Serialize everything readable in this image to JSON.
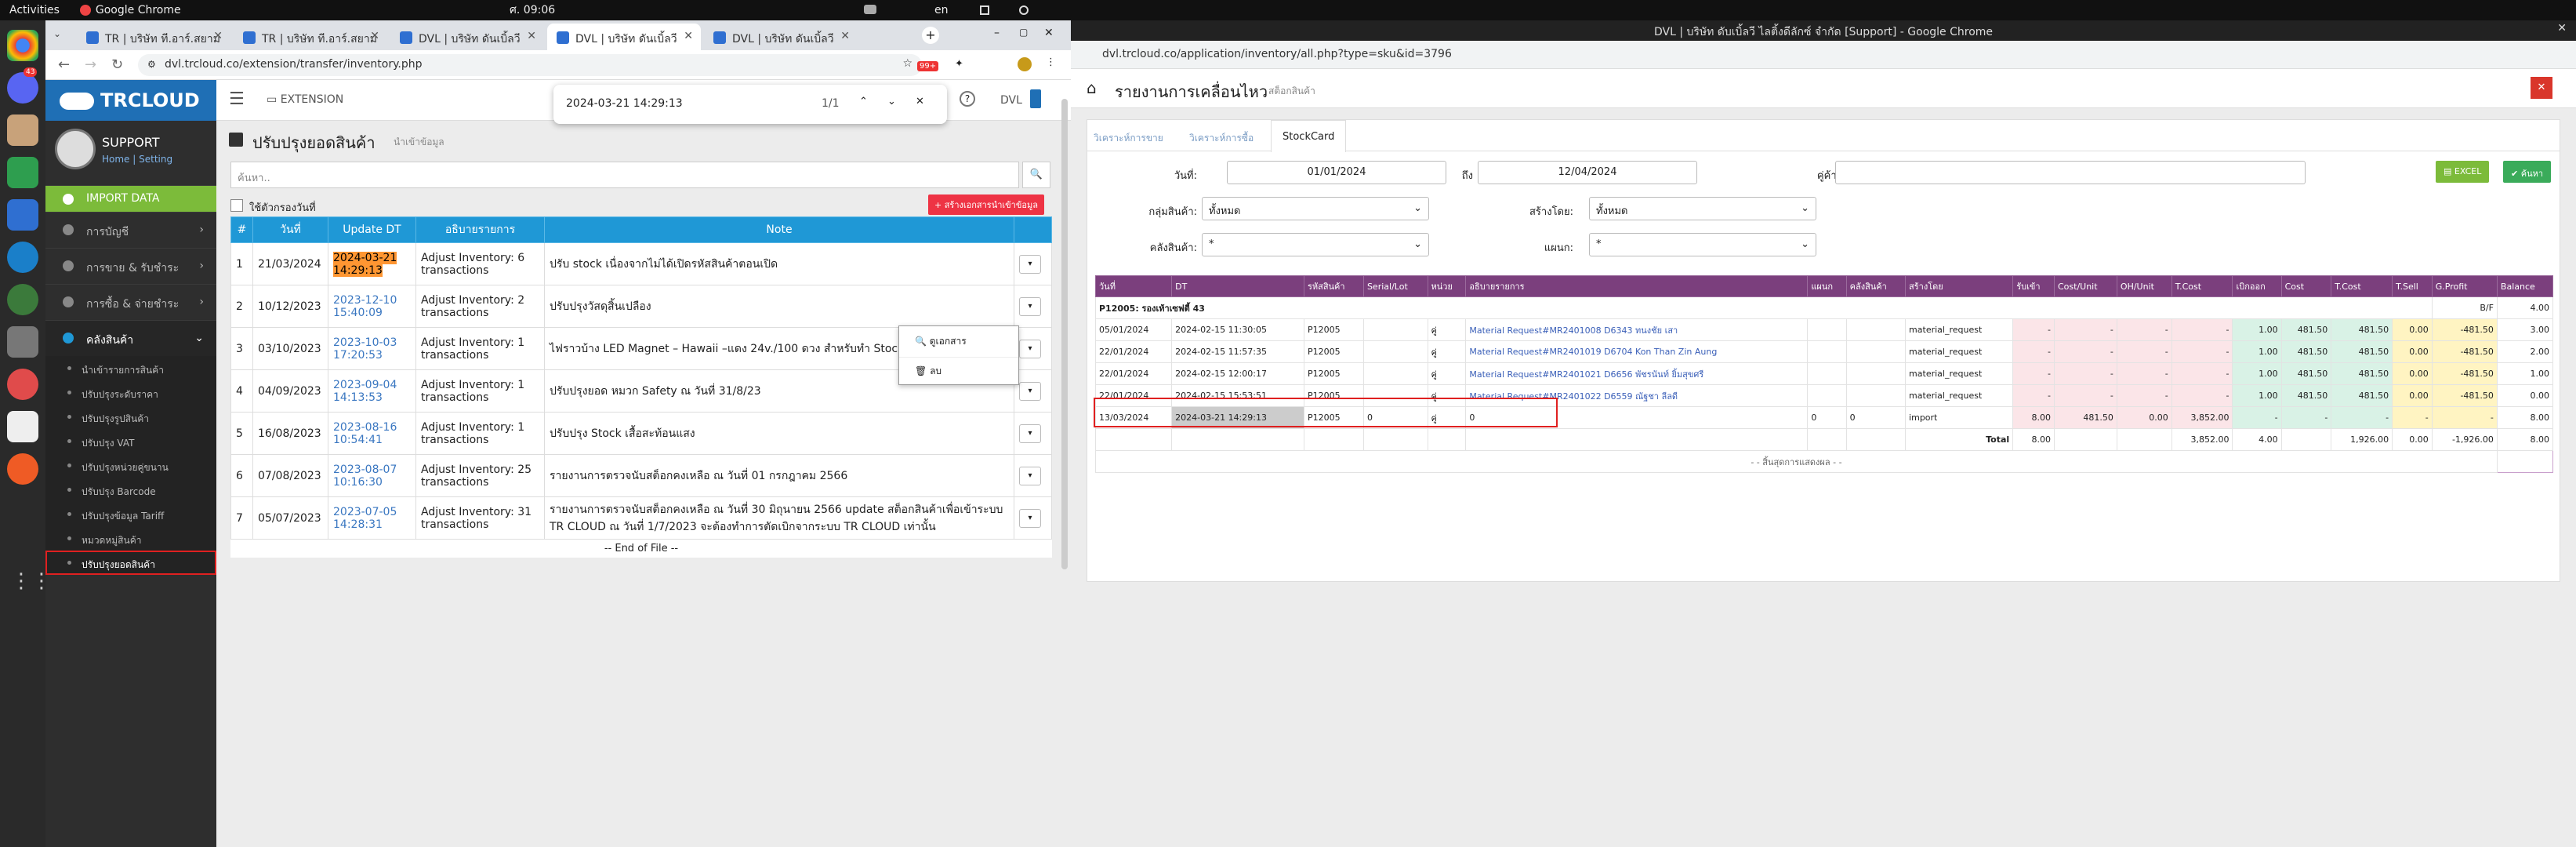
{
  "topbar": {
    "activities": "Activities",
    "app": "Google Chrome",
    "clock": "ศ. 09:06",
    "lang": "en"
  },
  "dock": {
    "badge": "43"
  },
  "left_window": {
    "tabs": [
      {
        "label": "TR | บริษัท ที.อาร์.สยาม"
      },
      {
        "label": "TR | บริษัท ที.อาร์.สยาม"
      },
      {
        "label": "DVL | บริษัท ดันเบิ้ลวี"
      },
      {
        "label": "DVL | บริษัท ดันเบิ้ลวี"
      },
      {
        "label": "DVL | บริษัท ดันเบิ้ลวี"
      }
    ],
    "url": "dvl.trcloud.co/extension/transfer/inventory.php",
    "ext_badge": "99+",
    "find": {
      "query": "2024-03-21 14:29:13",
      "count": "1/1"
    },
    "sidebar": {
      "logo": "TRCLOUD",
      "user": "SUPPORT",
      "home": "Home",
      "setting": "Setting",
      "menu": [
        {
          "label": "IMPORT DATA"
        },
        {
          "label": "การบัญชี"
        },
        {
          "label": "การขาย & รับชำระ"
        },
        {
          "label": "การซื้อ & จ่ายชำระ"
        },
        {
          "label": "คลังสินค้า"
        }
      ],
      "sub": [
        "นำเข้ารายการสินค้า",
        "ปรับปรุงระดับราคา",
        "ปรับปรุงรูปสินค้า",
        "ปรับปรุง VAT",
        "ปรับปรุงหน่วยคู่ขนาน",
        "ปรับปรุง Barcode",
        "ปรับปรุงข้อมูล Tariff",
        "หมวดหมู่สินค้า",
        "ปรับปรุงยอดสินค้า"
      ]
    },
    "header": {
      "extension": "EXTENSION",
      "dvl": "DVL"
    },
    "page": {
      "title": "ปรับปรุงยอดสินค้า",
      "subtitle": "นำเข้าข้อมูล",
      "search_placeholder": "ค้นหา..",
      "checkbox": "ใช้ตัวกรองวันที่",
      "create_btn": "+ สร้างเอกสารนำเข้าข้อมูล",
      "columns": [
        "#",
        "วันที่",
        "Update DT",
        "อธิบายรายการ",
        "Note"
      ],
      "rows": [
        {
          "n": "1",
          "date": "21/03/2024",
          "dt": "2024-03-21 14:29:13",
          "desc": "Adjust Inventory: 6 transactions",
          "note": "ปรับ stock เนื่องจากไม่ได้เปิดรหัสสินค้าตอนเปิด"
        },
        {
          "n": "2",
          "date": "10/12/2023",
          "dt": "2023-12-10 15:40:09",
          "desc": "Adjust Inventory: 2 transactions",
          "note": "ปรับปรุงวัสดุสิ้นเปลือง"
        },
        {
          "n": "3",
          "date": "03/10/2023",
          "dt": "2023-10-03 17:20:53",
          "desc": "Adjust Inventory: 1 transactions",
          "note": "ไฟราวบ้าง LED Magnet – Hawaii –แดง 24v./100 ดวง สำหรับทำ Stock"
        },
        {
          "n": "4",
          "date": "04/09/2023",
          "dt": "2023-09-04 14:13:53",
          "desc": "Adjust Inventory: 1 transactions",
          "note": "ปรับปรุงยอด หมวก Safety ณ วันที่ 31/8/23"
        },
        {
          "n": "5",
          "date": "16/08/2023",
          "dt": "2023-08-16 10:54:41",
          "desc": "Adjust Inventory: 1 transactions",
          "note": "ปรับปรุง Stock เสื้อสะท้อนแสง"
        },
        {
          "n": "6",
          "date": "07/08/2023",
          "dt": "2023-08-07 10:16:30",
          "desc": "Adjust Inventory: 25 transactions",
          "note": "รายงานการตรวจนับสต็อกคงเหลือ ณ วันที่ 01 กรกฎาคม 2566"
        },
        {
          "n": "7",
          "date": "05/07/2023",
          "dt": "2023-07-05 14:28:31",
          "desc": "Adjust Inventory: 31 transactions",
          "note": "รายงานการตรวจนับสต็อกคงเหลือ ณ วันที่ 30 มิถุนายน 2566 update สต็อกสินค้าเพื่อเข้าระบบ TR CLOUD ณ วันที่ 1/7/2023 จะต้องทำการตัดเบิกจากระบบ TR CLOUD เท่านั้น"
        }
      ],
      "end": "-- End of File --",
      "dropdown": [
        "ดูเอกสาร",
        "ลบ"
      ]
    }
  },
  "right_window": {
    "title": "DVL | บริษัท ดับเบิ้ลวี ไลติ้งดีลักซ์ จำกัด [Support] - Google Chrome",
    "url": "dvl.trcloud.co/application/inventory/all.php?type=sku&id=3796",
    "page_title": "รายงานการเคลื่อนไหว",
    "page_sub": "สต็อกสินค้า",
    "tabs": [
      "วิเคราะห์การขาย",
      "วิเคราะห์การซื้อ",
      "StockCard"
    ],
    "filters": {
      "date_label": "วันที่:",
      "date_from": "01/01/2024",
      "to": "ถึง",
      "date_to": "12/04/2024",
      "partner_label": "คู่ค้า:",
      "group_label": "กลุ่มสินค้า:",
      "group_val": "ทั้งหมด",
      "by_label": "สร้างโดย:",
      "by_val": "ทั้งหมด",
      "wh_label": "คลังสินค้า:",
      "wh_val": "*",
      "dept_label": "แผนก:",
      "dept_val": "*",
      "excel": "EXCEL",
      "search": "ค้นหา"
    },
    "columns": [
      "วันที่",
      "DT",
      "รหัสสินค้า",
      "Serial/Lot",
      "หน่วย",
      "อธิบายรายการ",
      "แผนก",
      "คลังสินค้า",
      "สร้างโดย",
      "รับเข้า",
      "Cost/Unit",
      "OH/Unit",
      "T.Cost",
      "เบิกออก",
      "Cost",
      "T.Cost",
      "T.Sell",
      "G.Profit",
      "Balance"
    ],
    "group_row": {
      "label": "P12005: รองเท้าเซฟตี้ 43",
      "bf": "B/F",
      "bal": "4.00"
    },
    "rows": [
      {
        "d": "05/01/2024",
        "dt": "2024-02-15 11:30:05",
        "code": "P12005",
        "unit": "คู่",
        "desc": "Material Request#MR2401008 D6343 ทนงชัย เสา",
        "by": "material_request",
        "in": "-",
        "cu": "-",
        "oh": "-",
        "tc": "-",
        "out": "1.00",
        "c": "481.50",
        "tc2": "481.50",
        "ts": "0.00",
        "gp": "-481.50",
        "bal": "3.00"
      },
      {
        "d": "22/01/2024",
        "dt": "2024-02-15 11:57:35",
        "code": "P12005",
        "unit": "คู่",
        "desc": "Material Request#MR2401019 D6704 Kon Than Zin Aung",
        "by": "material_request",
        "in": "-",
        "cu": "-",
        "oh": "-",
        "tc": "-",
        "out": "1.00",
        "c": "481.50",
        "tc2": "481.50",
        "ts": "0.00",
        "gp": "-481.50",
        "bal": "2.00"
      },
      {
        "d": "22/01/2024",
        "dt": "2024-02-15 12:00:17",
        "code": "P12005",
        "unit": "คู่",
        "desc": "Material Request#MR2401021 D6656 พัชรนันท์ ยิ้มสุขศรี",
        "by": "material_request",
        "in": "-",
        "cu": "-",
        "oh": "-",
        "tc": "-",
        "out": "1.00",
        "c": "481.50",
        "tc2": "481.50",
        "ts": "0.00",
        "gp": "-481.50",
        "bal": "1.00"
      },
      {
        "d": "22/01/2024",
        "dt": "2024-02-15 15:53:51",
        "code": "P12005",
        "unit": "คู่",
        "desc": "Material Request#MR2401022 D6559 ณัฐชา ลีลดี",
        "by": "material_request",
        "in": "-",
        "cu": "-",
        "oh": "-",
        "tc": "-",
        "out": "1.00",
        "c": "481.50",
        "tc2": "481.50",
        "ts": "0.00",
        "gp": "-481.50",
        "bal": "0.00"
      },
      {
        "d": "13/03/2024",
        "dt": "2024-03-21 14:29:13",
        "code": "P12005",
        "serial": "0",
        "unit": "คู่",
        "desc": "0",
        "dept": "0",
        "wh": "0",
        "by": "import",
        "in": "8.00",
        "cu": "481.50",
        "oh": "0.00",
        "tc": "3,852.00",
        "out": "-",
        "c": "-",
        "tc2": "-",
        "ts": "-",
        "gp": "-",
        "bal": "8.00"
      }
    ],
    "total": {
      "label": "Total",
      "in": "8.00",
      "tc": "3,852.00",
      "out": "4.00",
      "tc2": "1,926.00",
      "ts": "0.00",
      "gp": "-1,926.00",
      "bal": "8.00"
    },
    "end_note": "- - สิ้นสุดการแสดงผล - -"
  }
}
